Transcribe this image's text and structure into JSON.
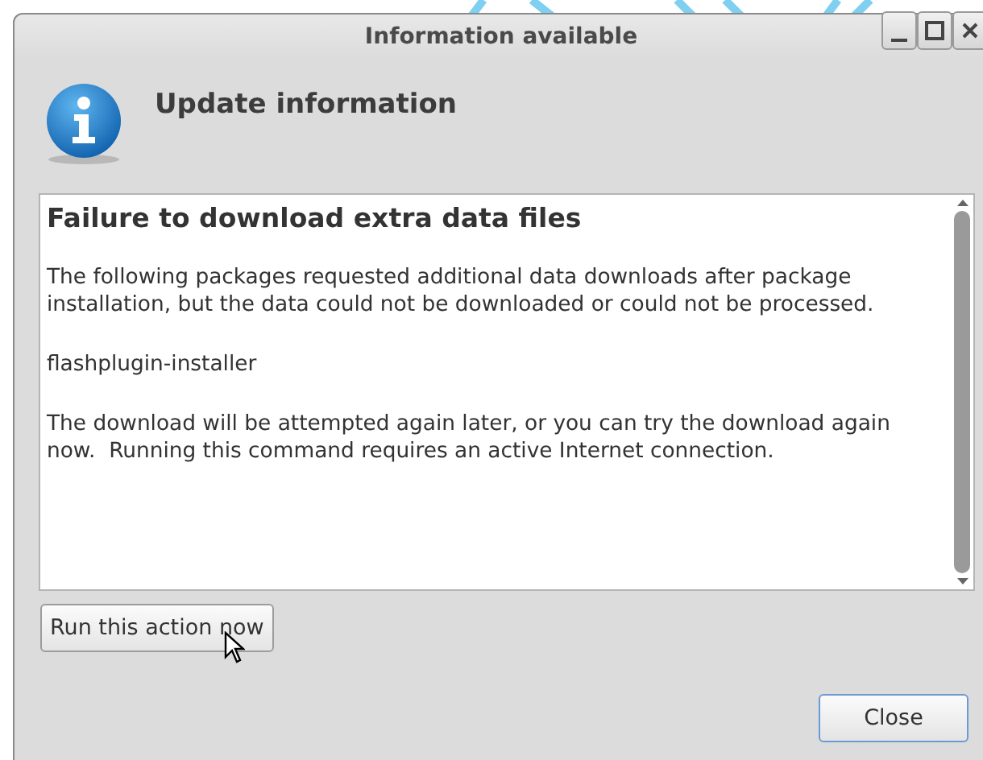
{
  "window": {
    "title": "Information available"
  },
  "header": {
    "title": "Update information"
  },
  "message": {
    "heading": "Failure to download extra data files",
    "paragraphs": [
      "The following packages requested additional data downloads after package installation, but the data could not be downloaded or could not be processed.",
      "flashplugin-installer",
      "The download will be attempted again later, or you can try the download again now.  Running this command requires an active Internet connection."
    ]
  },
  "buttons": [
    {
      "label": "Run this action now",
      "kind": "action"
    },
    {
      "label": "Close",
      "kind": "default"
    }
  ]
}
